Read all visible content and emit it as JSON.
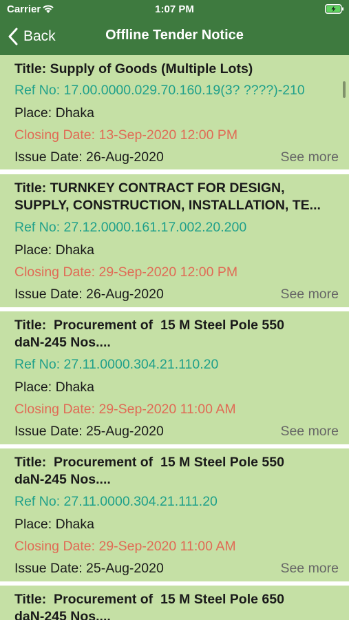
{
  "status_bar": {
    "carrier": "Carrier",
    "time": "1:07 PM",
    "wifi_icon": "wifi-icon",
    "battery_icon": "battery-charging-icon"
  },
  "nav": {
    "back_label": "Back",
    "title": "Offline Tender Notice",
    "back_icon": "chevron-left-icon"
  },
  "colors": {
    "header_bg": "#3e7a3f",
    "card_bg": "#c5e0a5",
    "ref_color": "#1fa08a",
    "closing_color": "#e06b55",
    "see_more_color": "#666666"
  },
  "tenders": [
    {
      "title": "Title: Supply of Goods (Multiple Lots)",
      "ref": "Ref No: 17.00.0000.029.70.160.19(3? ????)-210",
      "place": "Place: Dhaka",
      "closing": "Closing Date: 13-Sep-2020 12:00 PM",
      "issue": "Issue Date: 26-Aug-2020",
      "see_more": "See more"
    },
    {
      "title": "Title: TURNKEY CONTRACT FOR DESIGN,\nSUPPLY, CONSTRUCTION, INSTALLATION, TE...",
      "ref": "Ref No: 27.12.0000.161.17.002.20.200",
      "place": "Place: Dhaka",
      "closing": "Closing Date: 29-Sep-2020 12:00 PM",
      "issue": "Issue Date: 26-Aug-2020",
      "see_more": "See more"
    },
    {
      "title": "Title:  Procurement of  15 M Steel Pole 550\ndaN-245 Nos....",
      "ref": "Ref No: 27.11.0000.304.21.110.20",
      "place": "Place: Dhaka",
      "closing": "Closing Date: 29-Sep-2020 11:00 AM",
      "issue": "Issue Date: 25-Aug-2020",
      "see_more": "See more"
    },
    {
      "title": "Title:  Procurement of  15 M Steel Pole 550\ndaN-245 Nos....",
      "ref": "Ref No: 27.11.0000.304.21.111.20",
      "place": "Place: Dhaka",
      "closing": "Closing Date: 29-Sep-2020 11:00 AM",
      "issue": "Issue Date: 25-Aug-2020",
      "see_more": "See more"
    },
    {
      "title": "Title:  Procurement of  15 M Steel Pole 650\ndaN-245 Nos....",
      "ref": "",
      "place": "",
      "closing": "",
      "issue": "",
      "see_more": ""
    }
  ]
}
